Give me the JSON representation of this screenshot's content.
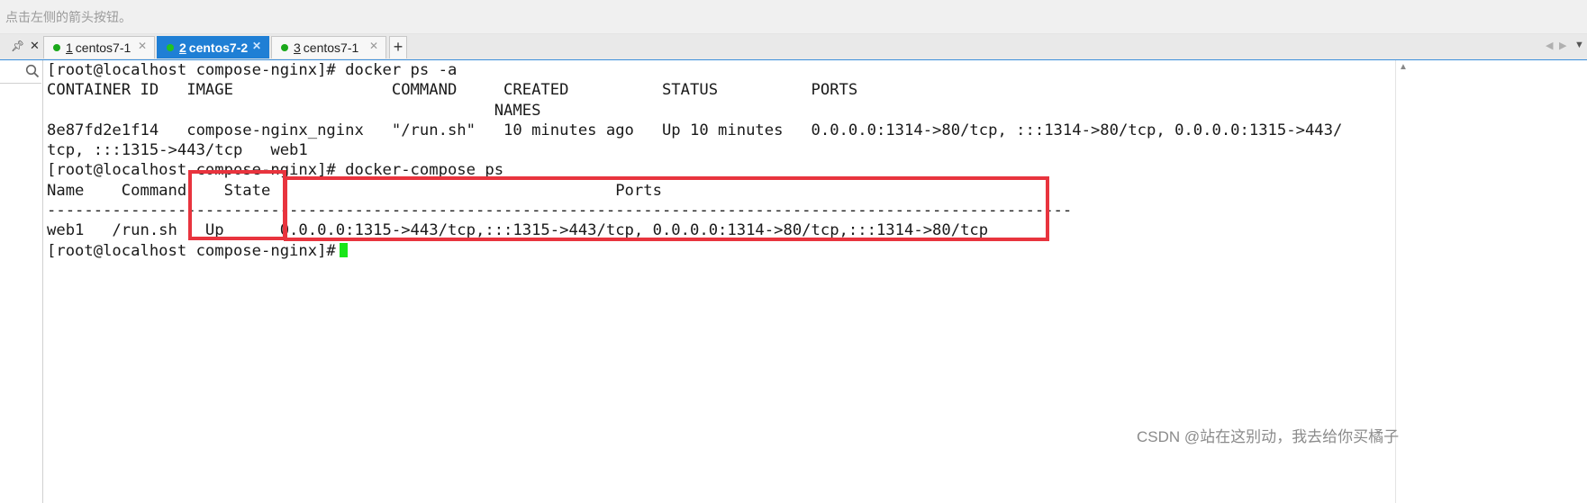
{
  "hint": "点击左侧的箭头按钮。",
  "tabs": [
    {
      "num": "1",
      "name": "centos7-1",
      "active": false
    },
    {
      "num": "2",
      "name": "centos7-2",
      "active": true
    },
    {
      "num": "3",
      "name": "centos7-1",
      "active": false
    }
  ],
  "terminal": {
    "lines": [
      "[root@localhost compose-nginx]# docker ps -a",
      "CONTAINER ID   IMAGE                 COMMAND     CREATED          STATUS          PORTS",
      "                                                NAMES",
      "8e87fd2e1f14   compose-nginx_nginx   \"/run.sh\"   10 minutes ago   Up 10 minutes   0.0.0.0:1314->80/tcp, :::1314->80/tcp, 0.0.0.0:1315->443/",
      "tcp, :::1315->443/tcp   web1",
      "[root@localhost compose-nginx]# docker-compose ps",
      "Name    Command    State                                     Ports",
      "--------------------------------------------------------------------------------------------------------------",
      "web1   /run.sh   Up      0.0.0.0:1315->443/tcp,:::1315->443/tcp, 0.0.0.0:1314->80/tcp,:::1314->80/tcp",
      "[root@localhost compose-nginx]#"
    ]
  },
  "colors": {
    "highlight": "#e8343e",
    "cursor": "#19e619",
    "active_tab": "#1f7fd5",
    "status_dot": "#1aa81a"
  },
  "icons": {
    "pin": "pin-icon",
    "close": "close-icon",
    "search": "search-icon",
    "add": "plus-icon"
  },
  "watermark": "CSDN @站在这别动，我去给你买橘子"
}
